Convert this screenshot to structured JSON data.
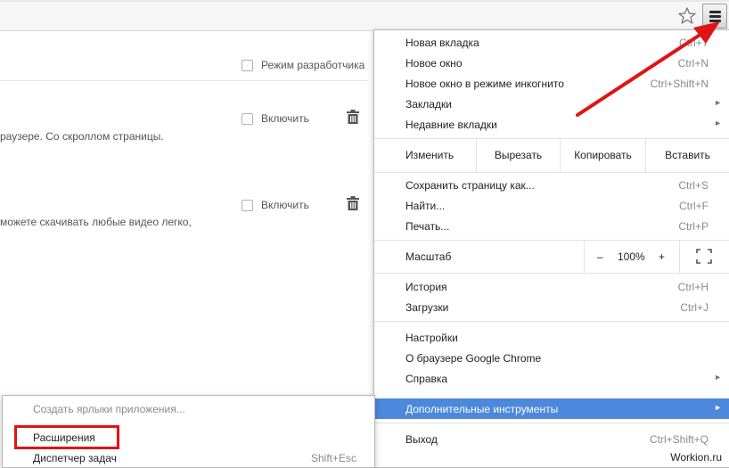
{
  "page": {
    "dev_mode_label": "Режим разработчика",
    "extensions": [
      {
        "description": "раузере. Со скроллом страницы.",
        "enable_label": "Включить"
      },
      {
        "description": " можете скачивать любые видео легко,",
        "enable_label": "Включить"
      }
    ]
  },
  "toolbar": {
    "bookmark_icon": "star-icon",
    "menu_icon": "hamburger-menu-icon"
  },
  "menu": {
    "group1": [
      {
        "label": "Новая вкладка",
        "shortcut": "Ctrl+T"
      },
      {
        "label": "Новое окно",
        "shortcut": "Ctrl+N"
      },
      {
        "label": "Новое окно в режиме инкогнито",
        "shortcut": "Ctrl+Shift+N"
      },
      {
        "label": "Закладки",
        "shortcut": ""
      },
      {
        "label": "Недавние вкладки",
        "shortcut": ""
      }
    ],
    "edit": {
      "label": "Изменить",
      "cut": "Вырезать",
      "copy": "Копировать",
      "paste": "Вставить"
    },
    "group2": [
      {
        "label": "Сохранить страницу как...",
        "shortcut": "Ctrl+S"
      },
      {
        "label": "Найти...",
        "shortcut": "Ctrl+F"
      },
      {
        "label": "Печать...",
        "shortcut": "Ctrl+P"
      }
    ],
    "zoom": {
      "label": "Масштаб",
      "minus": "–",
      "value": "100%",
      "plus": "+"
    },
    "group3": [
      {
        "label": "История",
        "shortcut": "Ctrl+H"
      },
      {
        "label": "Загрузки",
        "shortcut": "Ctrl+J"
      }
    ],
    "group4": [
      {
        "label": "Настройки"
      },
      {
        "label": "О браузере Google Chrome"
      },
      {
        "label": "Справка"
      }
    ],
    "more_tools": {
      "label": "Дополнительные инструменты"
    },
    "exit": {
      "label": "Выход",
      "shortcut": "Ctrl+Shift+Q"
    }
  },
  "submenu": {
    "items": [
      {
        "label": "Создать ярлыки приложения...",
        "shortcut": ""
      },
      {
        "label": "Расширения",
        "shortcut": ""
      },
      {
        "label": "Диспетчер задач",
        "shortcut": "Shift+Esc"
      }
    ]
  },
  "annotation": {
    "highlight_color": "#e01414",
    "menu_highlight_color": "#4c88dc"
  },
  "watermark": "Workion.ru"
}
